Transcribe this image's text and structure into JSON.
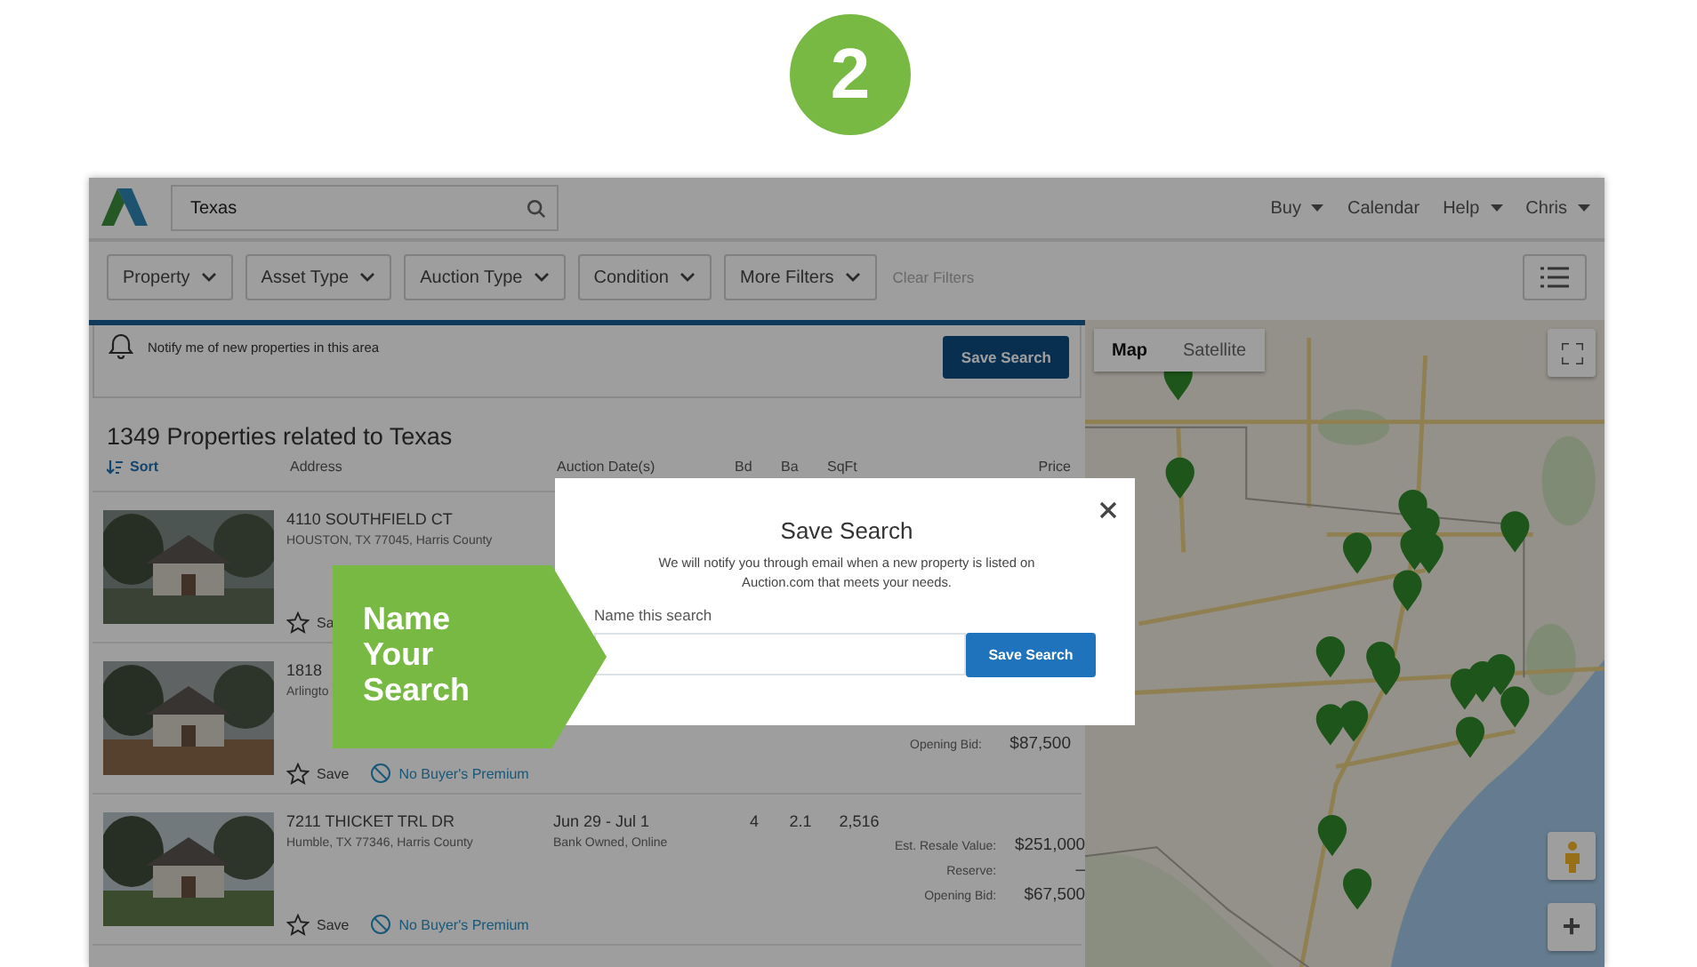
{
  "step_badge": "2",
  "header": {
    "search": {
      "value": "Texas"
    },
    "nav": [
      {
        "label": "Buy",
        "dropdown": true
      },
      {
        "label": "Calendar",
        "dropdown": false
      },
      {
        "label": "Help",
        "dropdown": true
      },
      {
        "label": "Chris",
        "dropdown": true
      }
    ]
  },
  "filters": [
    "Property",
    "Asset Type",
    "Auction Type",
    "Condition",
    "More Filters"
  ],
  "clear_filters": "Clear Filters",
  "notify": {
    "text": "Notify me of new properties in this area",
    "button": "Save Search"
  },
  "results_title": "1349 Properties related to Texas",
  "table": {
    "sort": "Sort",
    "columns": [
      "Address",
      "Auction Date(s)",
      "Bd",
      "Ba",
      "SqFt",
      "Price"
    ],
    "rows": [
      {
        "address": "4110 SOUTHFIELD CT",
        "city": "HOUSTON, TX 77045, Harris County",
        "save": "Sa"
      },
      {
        "address": "1818",
        "city": "Arlingto",
        "prices": [
          {
            "label": "Opening Bid:",
            "value": "$87,500"
          }
        ],
        "save": "Save",
        "premium": "No Buyer's Premium"
      },
      {
        "address": "7211 THICKET TRL DR",
        "city": "Humble, TX 77346, Harris County",
        "dates": "Jun 29 - Jul 1",
        "type": "Bank Owned, Online",
        "bd": "4",
        "ba": "2.1",
        "sqft": "2,516",
        "prices": [
          {
            "label": "Est. Resale Value:",
            "value": "$251,000"
          },
          {
            "label": "Reserve:",
            "value": "–"
          },
          {
            "label": "Opening Bid:",
            "value": "$67,500"
          }
        ],
        "save": "Save",
        "premium": "No Buyer's Premium"
      }
    ]
  },
  "map": {
    "tabs": [
      {
        "label": "Map",
        "selected": true
      },
      {
        "label": "Satellite",
        "selected": false
      }
    ],
    "zoom_in": "+"
  },
  "modal": {
    "title": "Save Search",
    "message": "We will notify you through email when a new property is listed on Auction.com that meets your needs.",
    "field_label": "Name this search",
    "button": "Save Search"
  },
  "callout": "Name Your Search"
}
